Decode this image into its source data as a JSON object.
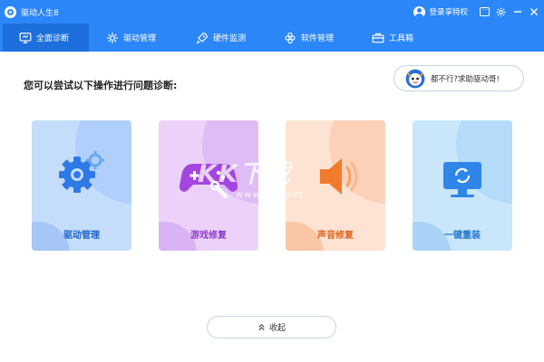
{
  "window": {
    "title": "驱动人生8"
  },
  "titlebar": {
    "login_label": "登录享特权",
    "message_icon": "message-icon",
    "settings_icon": "gear-icon",
    "minimize_icon": "minimize-icon",
    "close_icon": "close-icon"
  },
  "nav": {
    "tabs": [
      {
        "label": "全面诊断",
        "icon": "monitor-icon",
        "active": true
      },
      {
        "label": "驱动管理",
        "icon": "gear-icon",
        "active": false
      },
      {
        "label": "硬件监测",
        "icon": "rocket-icon",
        "active": false
      },
      {
        "label": "软件管理",
        "icon": "apps-icon",
        "active": false
      },
      {
        "label": "工具箱",
        "icon": "toolbox-icon",
        "active": false
      }
    ]
  },
  "main": {
    "prompt": "您可以尝试以下操作进行问题诊断:",
    "help_label": "都不行?求助驱动哥!",
    "cards": [
      {
        "label": "驱动管理",
        "icon": "gears-icon",
        "color": "#2364c8"
      },
      {
        "label": "游戏修复",
        "icon": "gamepad-wrench-icon",
        "color": "#8a3ec9"
      },
      {
        "label": "声音修复",
        "icon": "speaker-icon",
        "color": "#e0641f"
      },
      {
        "label": "一键重装",
        "icon": "monitor-refresh-icon",
        "color": "#2376c9"
      }
    ],
    "collapse_label": "收起"
  },
  "watermark": {
    "title": "KK下载",
    "url": "www.kkx.net"
  },
  "colors": {
    "accent": "#2b86f7",
    "active_tab": "#1c6fdc"
  }
}
